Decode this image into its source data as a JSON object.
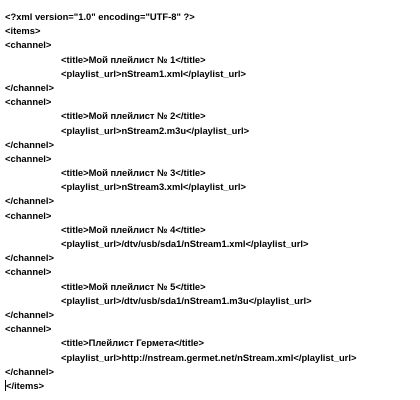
{
  "document": {
    "lines": [
      {
        "text": "<?xml version=\"1.0\" encoding=\"UTF-8\" ?>",
        "indent": false
      },
      {
        "text": "<items>",
        "indent": false
      },
      {
        "text": "<channel>",
        "indent": false
      },
      {
        "text": "<title>Мой плейлист № 1</title>",
        "indent": true
      },
      {
        "text": "<playlist_url>nStream1.xml</playlist_url>",
        "indent": true
      },
      {
        "text": "</channel>",
        "indent": false
      },
      {
        "text": "<channel>",
        "indent": false
      },
      {
        "text": "<title>Мой плейлист № 2</title>",
        "indent": true
      },
      {
        "text": "<playlist_url>nStream2.m3u</playlist_url>",
        "indent": true
      },
      {
        "text": "</channel>",
        "indent": false
      },
      {
        "text": "<channel>",
        "indent": false
      },
      {
        "text": "<title>Мой плейлист № 3</title>",
        "indent": true
      },
      {
        "text": "<playlist_url>nStream3.xml</playlist_url>",
        "indent": true
      },
      {
        "text": "</channel>",
        "indent": false
      },
      {
        "text": "<channel>",
        "indent": false
      },
      {
        "text": "<title>Мой плейлист № 4</title>",
        "indent": true
      },
      {
        "text": "<playlist_url>/dtv/usb/sda1/nStream1.xml</playlist_url>",
        "indent": true
      },
      {
        "text": "</channel>",
        "indent": false
      },
      {
        "text": "<channel>",
        "indent": false
      },
      {
        "text": "<title>Мой плейлист № 5</title>",
        "indent": true
      },
      {
        "text": "<playlist_url>/dtv/usb/sda1/nStream1.m3u</playlist_url>",
        "indent": true
      },
      {
        "text": "</channel>",
        "indent": false
      },
      {
        "text": "<channel>",
        "indent": false
      },
      {
        "text": "<title>Плейлист Гермета</title>",
        "indent": true
      },
      {
        "text": "<playlist_url>http://nstream.germet.net/nStream.xml</playlist_url>",
        "indent": true
      },
      {
        "text": "</channel>",
        "indent": false
      },
      {
        "text": "</items>",
        "indent": false,
        "caret": true
      }
    ]
  }
}
